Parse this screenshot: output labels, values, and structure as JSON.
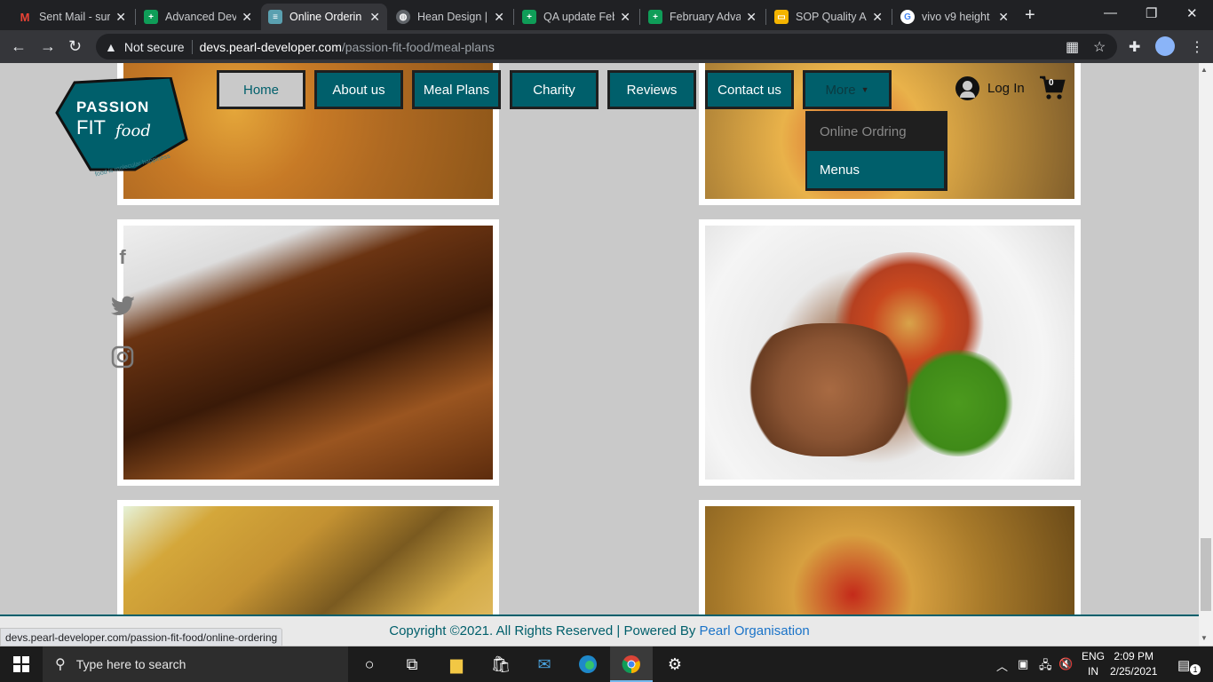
{
  "browser": {
    "tabs": [
      {
        "title": "Sent Mail - sur",
        "icon": "gmail-icon",
        "color": "#ea4335",
        "glyph": "M"
      },
      {
        "title": "Advanced Dev",
        "icon": "sheets-icon",
        "color": "#0f9d58",
        "glyph": "+"
      },
      {
        "title": "Online Orderin",
        "icon": "site-icon",
        "color": "#5aa0b0",
        "glyph": "≡"
      },
      {
        "title": "Hean Design |",
        "icon": "globe-icon",
        "color": "#5f6368",
        "glyph": "◍"
      },
      {
        "title": "QA update Feb",
        "icon": "sheets-icon",
        "color": "#0f9d58",
        "glyph": "+"
      },
      {
        "title": "February Adva",
        "icon": "sheets-icon",
        "color": "#0f9d58",
        "glyph": "+"
      },
      {
        "title": "SOP Quality A",
        "icon": "slides-icon",
        "color": "#f4b400",
        "glyph": "▭"
      },
      {
        "title": "vivo v9 height",
        "icon": "google-icon",
        "color": "#ffffff",
        "glyph": "G"
      }
    ],
    "security_label": "Not secure",
    "url_host": "devs.pearl-developer.com",
    "url_path": "/passion-fit-food/meal-plans",
    "status_url": "devs.pearl-developer.com/passion-fit-food/online-ordering"
  },
  "site": {
    "logo": {
      "line1": "PASSION",
      "line2": "FIT",
      "line3": "food",
      "tagline": "food is molecular happiness"
    },
    "nav": [
      "Home",
      "About us",
      "Meal Plans",
      "Charity",
      "Reviews",
      "Contact us"
    ],
    "more_label": "More",
    "dropdown": [
      "Online Ordring",
      "Menus"
    ],
    "login_label": "Log In",
    "cart_count": "0",
    "social": {
      "facebook": "f",
      "twitter": "🐦",
      "instagram": "◎"
    },
    "footer": {
      "text": "Copyright ©2021. All Rights Reserved | Powered By ",
      "link": "Pearl Organisation"
    },
    "colors": {
      "accent": "#005f6b",
      "background": "#c9c9c9"
    }
  },
  "taskbar": {
    "search_placeholder": "Type here to search",
    "lang_top": "ENG",
    "lang_bottom": "IN",
    "time": "2:09 PM",
    "date": "2/25/2021",
    "notification_count": "1"
  }
}
